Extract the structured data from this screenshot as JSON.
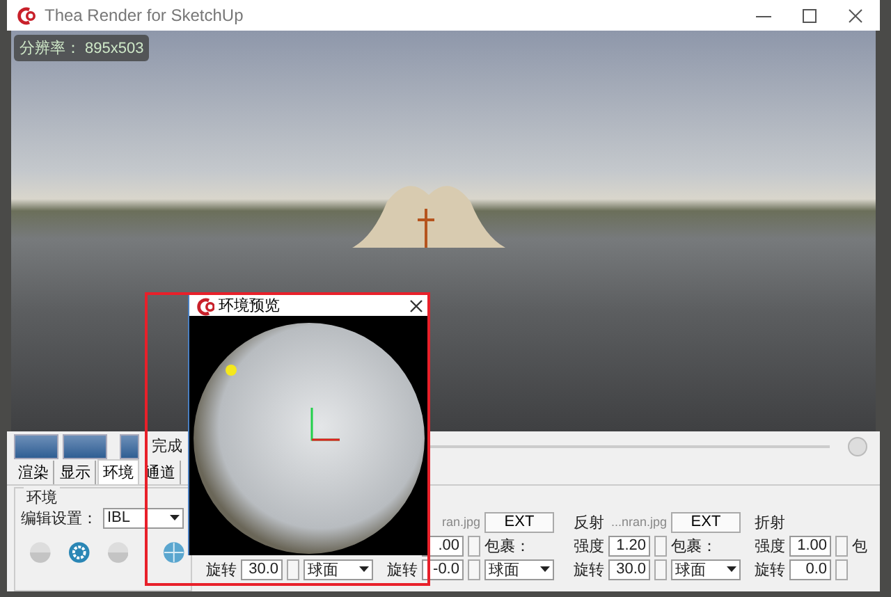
{
  "window": {
    "title": "Thea Render for SketchUp"
  },
  "viewport": {
    "resolution_badge": "分辨率： 895x503"
  },
  "toolbar": {
    "status": "完成"
  },
  "tabs": [
    {
      "label": "渲染",
      "selected": false
    },
    {
      "label": "显示",
      "selected": false
    },
    {
      "label": "环境",
      "selected": true
    },
    {
      "label": "通道",
      "selected": false
    }
  ],
  "environment_group": {
    "title": "环境",
    "field_label": "编辑设置：",
    "preset": "IBL"
  },
  "map_columns": [
    {
      "rotation": {
        "label": "旋转",
        "value": "30.0",
        "wrap": "球面"
      }
    },
    {
      "header": {
        "file": "ran.jpg",
        "button": "EXT"
      },
      "intensity": {
        "value": ".00",
        "wrap_label": "包裹："
      },
      "rotation": {
        "label": "旋转",
        "value": "-0.0",
        "wrap": "球面"
      }
    },
    {
      "header": {
        "label": "反射",
        "file": "...nran.jpg",
        "button": "EXT"
      },
      "intensity": {
        "label": "强度",
        "value": "1.20",
        "wrap_label": "包裹："
      },
      "rotation": {
        "label": "旋转",
        "value": "30.0",
        "wrap": "球面"
      }
    },
    {
      "header": {
        "label": "折射"
      },
      "intensity": {
        "label": "强度",
        "value": "1.00",
        "wrap_label": "包"
      },
      "rotation": {
        "label": "旋转",
        "value": "0.0"
      }
    }
  ],
  "preview_dialog": {
    "title": "环境预览"
  }
}
